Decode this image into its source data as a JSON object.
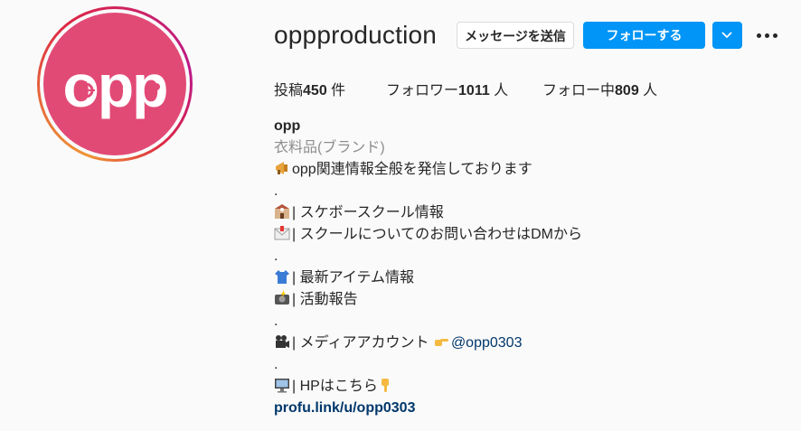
{
  "profile": {
    "username": "oppproduction",
    "avatar_text": "opp"
  },
  "actions": {
    "message_label": "メッセージを送信",
    "follow_label": "フォローする"
  },
  "stats": {
    "posts_label": "投稿",
    "posts_count": "450",
    "posts_unit": " 件",
    "followers_label": "フォロワー",
    "followers_count": "1011",
    "followers_unit": " 人",
    "following_label": "フォロー中",
    "following_count": "809",
    "following_unit": " 人"
  },
  "bio": {
    "name": "opp",
    "category": "衣料品(ブランド)",
    "line1": "opp関連情報全般を発信しております",
    "dot1": ".",
    "line2": "| スケボースクール情報",
    "line3": "| スクールについてのお問い合わせはDMから",
    "dot2": ".",
    "line4": "| 最新アイテム情報",
    "line5": "| 活動報告",
    "dot3": ".",
    "line6": "| メディアアカウント ",
    "mention": "@opp0303",
    "dot4": ".",
    "line7": "| HPはこちら",
    "link": "profu.link/u/opp0303"
  },
  "colors": {
    "accent": "#0095f6",
    "avatar_bg": "#e24a76",
    "link": "#00376b"
  }
}
